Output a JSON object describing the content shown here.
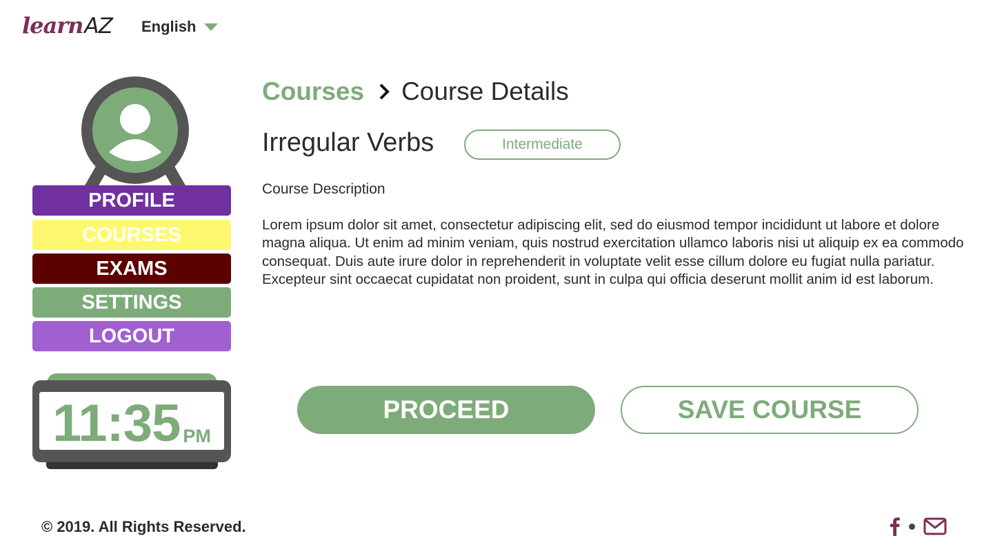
{
  "header": {
    "logo_learn": "learn",
    "logo_az": "AZ",
    "language": "English"
  },
  "sidebar": {
    "menu": [
      {
        "label": "PROFILE"
      },
      {
        "label": "COURSES"
      },
      {
        "label": "EXAMS"
      },
      {
        "label": "SETTINGS"
      },
      {
        "label": "LOGOUT"
      }
    ],
    "clock": {
      "time": "11:35",
      "ampm": "PM"
    }
  },
  "main": {
    "breadcrumb": {
      "parent": "Courses",
      "current": "Course Details"
    },
    "course_title": "Irregular Verbs",
    "level": "Intermediate",
    "description_label": "Course Description",
    "description": "Lorem ipsum dolor sit amet, consectetur adipiscing elit, sed do eiusmod tempor incididunt ut labore et dolore magna aliqua. Ut enim ad minim veniam, quis nostrud exercitation ullamco laboris nisi ut aliquip ex ea commodo consequat. Duis aute irure dolor in reprehenderit in voluptate velit esse cillum dolore eu fugiat nulla pariatur. Excepteur sint occaecat cupidatat non proident, sunt in culpa qui officia deserunt mollit anim id est laborum.",
    "proceed_label": "PROCEED",
    "save_label": "SAVE COURSE"
  },
  "footer": {
    "copyright": "© 2019. All Rights Reserved.",
    "icons": [
      "facebook-icon",
      "mail-icon"
    ]
  },
  "colors": {
    "accent_green": "#7eab7a",
    "brand_purple": "#7a2f5a",
    "profile": "#7030a0",
    "courses": "#fdf870",
    "exams": "#5c0000",
    "settings": "#7eab7a",
    "logout": "#a060d0"
  }
}
